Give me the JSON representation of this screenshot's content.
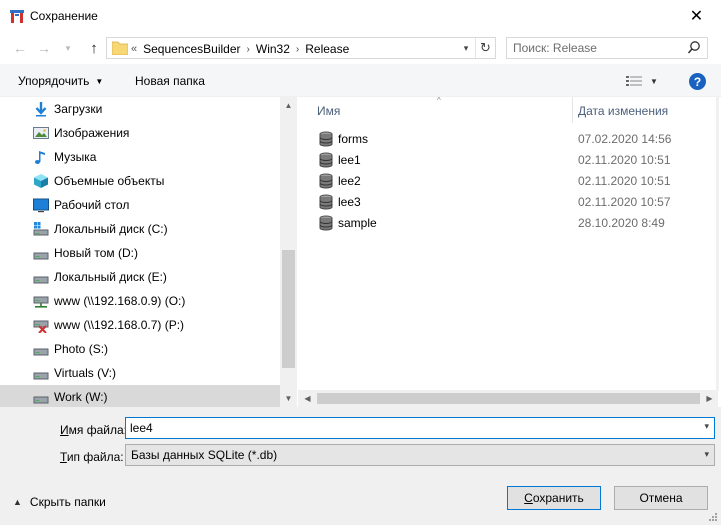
{
  "window": {
    "title": "Сохранение",
    "close_glyph": "✕"
  },
  "nav": {
    "back_glyph": "←",
    "forward_glyph": "→",
    "recent_glyph": "▾",
    "up_glyph": "↑",
    "overflow_glyph": "«",
    "breadcrumbs": [
      "SequencesBuilder",
      "Win32",
      "Release"
    ],
    "separator_glyph": "›",
    "dropdown_glyph": "▾",
    "refresh_glyph": "↻"
  },
  "search": {
    "placeholder": "Поиск: Release",
    "icon_glyph": "⌕"
  },
  "toolbar": {
    "organize_label": "Упорядочить",
    "organize_caret": "▼",
    "new_folder_label": "Новая папка",
    "view_caret": "▼",
    "help_label": "?"
  },
  "tree": [
    {
      "label": "Загрузки",
      "icon": "downloads-icon"
    },
    {
      "label": "Изображения",
      "icon": "pictures-icon"
    },
    {
      "label": "Музыка",
      "icon": "music-icon"
    },
    {
      "label": "Объемные объекты",
      "icon": "3d-objects-icon"
    },
    {
      "label": "Рабочий стол",
      "icon": "desktop-icon"
    },
    {
      "label": "Локальный диск (C:)",
      "icon": "system-drive-icon"
    },
    {
      "label": "Новый том (D:)",
      "icon": "drive-icon"
    },
    {
      "label": "Локальный диск (E:)",
      "icon": "drive-icon"
    },
    {
      "label": "www (\\\\192.168.0.9) (O:)",
      "icon": "network-drive-icon"
    },
    {
      "label": "www (\\\\192.168.0.7) (P:)",
      "icon": "network-drive-disconnected-icon"
    },
    {
      "label": "Photo (S:)",
      "icon": "drive-icon"
    },
    {
      "label": "Virtuals (V:)",
      "icon": "drive-icon"
    },
    {
      "label": "Work (W:)",
      "icon": "drive-icon",
      "selected": true
    }
  ],
  "columns": {
    "name": "Имя",
    "date": "Дата изменения",
    "sort_glyph": "^"
  },
  "files": [
    {
      "name": "forms",
      "date": "07.02.2020 14:56",
      "icon": "database-file-icon"
    },
    {
      "name": "lee1",
      "date": "02.11.2020 10:51",
      "icon": "database-file-icon"
    },
    {
      "name": "lee2",
      "date": "02.11.2020 10:51",
      "icon": "database-file-icon"
    },
    {
      "name": "lee3",
      "date": "02.11.2020 10:57",
      "icon": "database-file-icon"
    },
    {
      "name": "sample",
      "date": "28.10.2020 8:49",
      "icon": "database-file-icon"
    }
  ],
  "scroll_glyphs": {
    "up": "▲",
    "down": "▼",
    "left": "◀",
    "right": "▶"
  },
  "bottom": {
    "filename_label_prefix": "И",
    "filename_label_rest": "мя файла:",
    "filename_value": "lee4",
    "filename_caret": "▾",
    "filetype_label_prefix": "Т",
    "filetype_label_rest": "ип файла:",
    "filetype_value": "Базы данных SQLite (*.db)",
    "filetype_caret": "▾",
    "hide_folders_caret": "▲",
    "hide_folders_label": "Скрыть папки",
    "save_label_prefix": "С",
    "save_label_rest": "охранить",
    "cancel_label": "Отмена"
  },
  "colors": {
    "accent": "#0078d7",
    "help": "#1a62c0",
    "column_header_text": "#4c607a",
    "date_text": "#6d6d6d",
    "selection": "#d9d9d9"
  }
}
